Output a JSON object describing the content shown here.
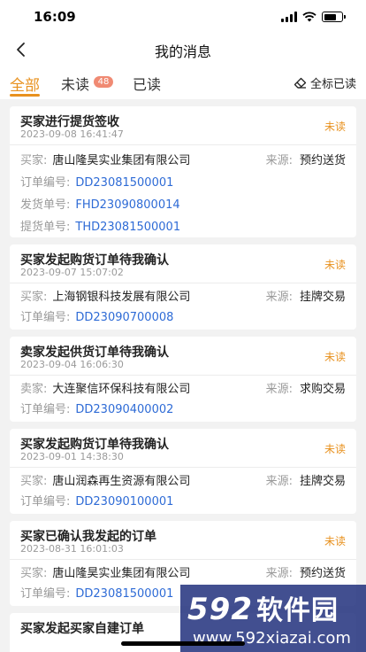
{
  "status_bar": {
    "time": "16:09"
  },
  "nav": {
    "title": "我的消息"
  },
  "tabs": {
    "all": "全部",
    "unread": "未读",
    "unread_count": "48",
    "read": "已读",
    "mark_all": "全标已读"
  },
  "colors": {
    "accent": "#e8911e",
    "link": "#2e6bd6",
    "badge": "#f08a73"
  },
  "messages": [
    {
      "title": "买家进行提货签收",
      "time": "2023-09-08 16:41:47",
      "status": "未读",
      "party_label": "买家:",
      "party": "唐山隆昊实业集团有限公司",
      "source_label": "来源:",
      "source": "预约送货",
      "fields": [
        {
          "label": "订单编号:",
          "value": "DD23081500001"
        },
        {
          "label": "发货单号:",
          "value": "FHD23090800014"
        },
        {
          "label": "提货单号:",
          "value": "THD23081500001"
        }
      ]
    },
    {
      "title": "买家发起购货订单待我确认",
      "time": "2023-09-07 15:07:02",
      "status": "未读",
      "party_label": "买家:",
      "party": "上海钢银科技发展有限公司",
      "source_label": "来源:",
      "source": "挂牌交易",
      "fields": [
        {
          "label": "订单编号:",
          "value": "DD23090700008"
        }
      ]
    },
    {
      "title": "卖家发起供货订单待我确认",
      "time": "2023-09-04 16:06:30",
      "status": "未读",
      "party_label": "卖家:",
      "party": "大连聚信环保科技有限公司",
      "source_label": "来源:",
      "source": "求购交易",
      "fields": [
        {
          "label": "订单编号:",
          "value": "DD23090400002"
        }
      ]
    },
    {
      "title": "买家发起购货订单待我确认",
      "time": "2023-09-01 14:38:30",
      "status": "未读",
      "party_label": "买家:",
      "party": "唐山润森再生资源有限公司",
      "source_label": "来源:",
      "source": "挂牌交易",
      "fields": [
        {
          "label": "订单编号:",
          "value": "DD23090100001"
        }
      ]
    },
    {
      "title": "买家已确认我发起的订单",
      "time": "2023-08-31 16:01:03",
      "status": "未读",
      "party_label": "买家:",
      "party": "唐山隆昊实业集团有限公司",
      "source_label": "来源:",
      "source": "预约送货",
      "fields": [
        {
          "label": "订单编号:",
          "value": "DD23081500001"
        }
      ]
    },
    {
      "title": "买家发起买家自建订单"
    }
  ],
  "watermark": {
    "line1_num": "592",
    "line1_cn": "软件园",
    "line2": "www.592xiazai.com"
  }
}
